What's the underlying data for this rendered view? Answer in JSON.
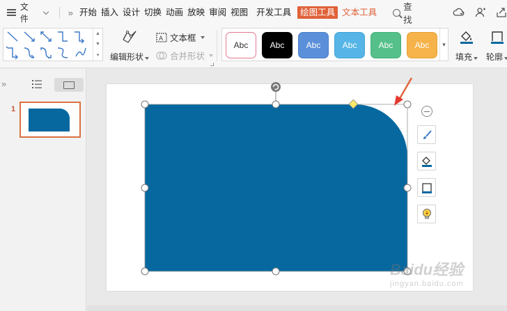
{
  "menubar": {
    "file_label": "文件",
    "tabs": [
      "开始",
      "插入",
      "设计",
      "切换",
      "动画",
      "放映",
      "审阅",
      "视图"
    ],
    "dev_tab": "开发工具",
    "active_tab": "绘图工具",
    "text_tool_tab": "文本工具",
    "search_label": "查找"
  },
  "ribbon": {
    "edit_shape_label": "编辑形状",
    "textbox_label": "文本框",
    "merge_shape_label": "合并形状",
    "styles": [
      {
        "label": "Abc",
        "bg": "#ffffff",
        "border": "#e07890",
        "color": "#333333"
      },
      {
        "label": "Abc",
        "bg": "#000000",
        "border": "#000000",
        "color": "#ffffff"
      },
      {
        "label": "Abc",
        "bg": "#5b8fd9",
        "border": "#4a7ec8",
        "color": "#ffffff"
      },
      {
        "label": "Abc",
        "bg": "#56b5e6",
        "border": "#45a4d5",
        "color": "#ffffff"
      },
      {
        "label": "Abc",
        "bg": "#56c08a",
        "border": "#45af79",
        "color": "#ffffff"
      },
      {
        "label": "Abc",
        "bg": "#f6b34a",
        "border": "#e5a239",
        "color": "#ffffff"
      }
    ],
    "fill_label": "填充",
    "outline_label": "轮廓"
  },
  "slides_panel": {
    "slide_number": "1"
  },
  "shape": {
    "fill_color": "#0768a0",
    "accent_color": "#e0623a"
  },
  "watermark": {
    "brand": "Baidu经验",
    "sub": "jingyan.baidu.com"
  }
}
